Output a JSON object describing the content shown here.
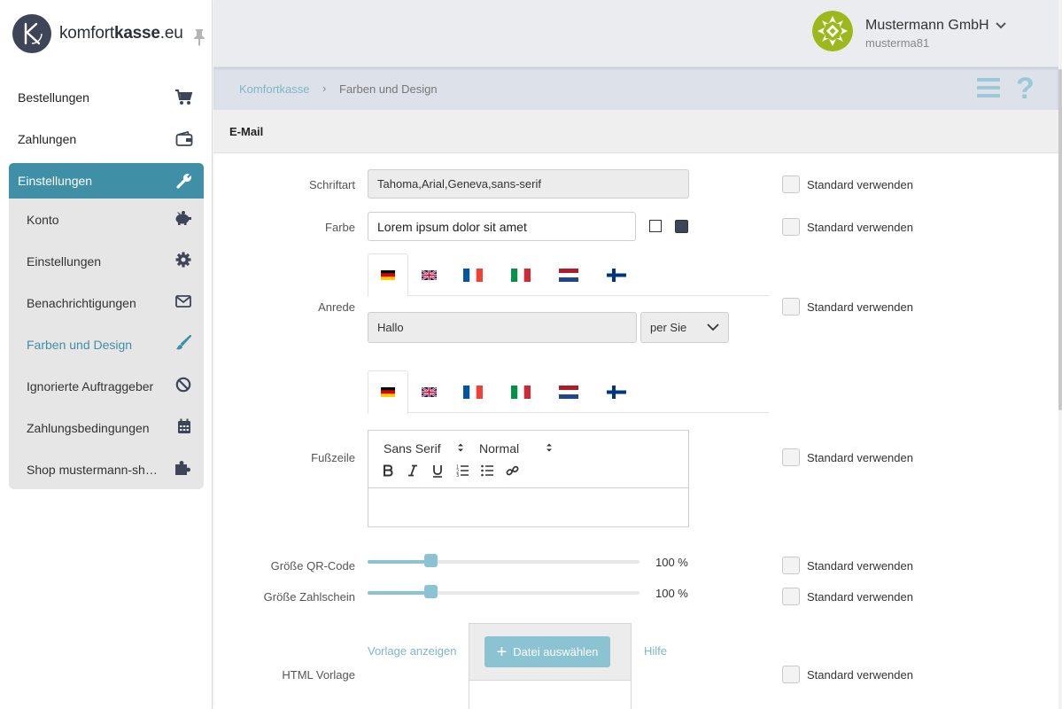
{
  "brand": {
    "name_regular": "komfort",
    "name_bold": "kasse",
    "name_suffix": ".eu"
  },
  "user": {
    "company": "Mustermann GmbH",
    "username": "musterma81"
  },
  "nav": {
    "bestellungen": "Bestellungen",
    "zahlungen": "Zahlungen",
    "einstellungen": "Einstellungen"
  },
  "subnav": [
    {
      "label": "Konto",
      "icon": "piggy-bank-icon"
    },
    {
      "label": "Einstellungen",
      "icon": "gear-icon"
    },
    {
      "label": "Benachrichtigungen",
      "icon": "envelope-icon"
    },
    {
      "label": "Farben und Design",
      "icon": "paintbrush-icon"
    },
    {
      "label": "Ignorierte Auftraggeber",
      "icon": "ban-icon"
    },
    {
      "label": "Zahlungsbedingungen",
      "icon": "calendar-icon"
    },
    {
      "label": "Shop mustermann-sh…",
      "icon": "puzzle-icon"
    }
  ],
  "breadcrumb": {
    "home": "Komfortkasse",
    "sep": "›",
    "current": "Farben und Design"
  },
  "section": {
    "title": "E-Mail"
  },
  "form": {
    "schriftart": {
      "label": "Schriftart",
      "value": "Tahoma,Arial,Geneva,sans-serif"
    },
    "farbe": {
      "label": "Farbe",
      "value": "Lorem ipsum dolor sit amet"
    },
    "anrede": {
      "label": "Anrede",
      "value": "Hallo",
      "select": "per Sie"
    },
    "fusszeile": {
      "label": "Fußzeile",
      "font": "Sans Serif",
      "size": "Normal"
    },
    "qr": {
      "label": "Größe QR-Code",
      "value": "100 %",
      "fraction": 0.23
    },
    "zahlschein": {
      "label": "Größe Zahlschein",
      "value": "100 %",
      "fraction": 0.23
    },
    "html": {
      "label": "HTML Vorlage",
      "show": "Vorlage anzeigen",
      "upload": "Datei auswählen",
      "help": "Hilfe"
    },
    "standard": "Standard verwenden"
  },
  "languages": [
    "de",
    "en",
    "fr",
    "it",
    "nl",
    "fi"
  ],
  "colors": {
    "accent": "#3f8fa6",
    "light_accent": "#8cc3d2",
    "link": "#7fb7c7"
  }
}
